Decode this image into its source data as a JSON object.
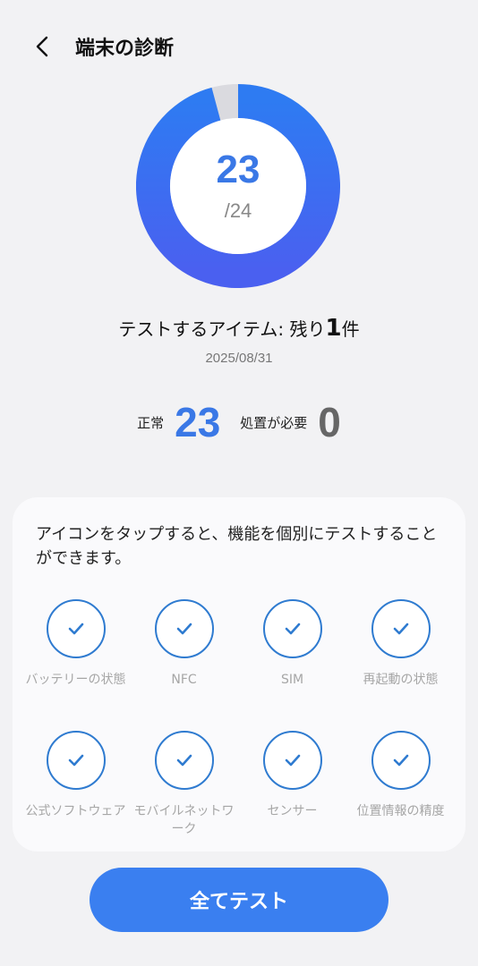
{
  "header": {
    "title": "端末の診断"
  },
  "ring": {
    "passed": 23,
    "count_text": "23",
    "total_text": "/24",
    "colors": {
      "arc_start": "#2e7bf2",
      "arc_end": "#4a60f0",
      "pending": "#d8d8dc"
    }
  },
  "remaining": {
    "prefix": "テストするアイテム: 残り",
    "count": "1",
    "suffix": "件"
  },
  "date": "2025/08/31",
  "stats": {
    "normal_label": "正常",
    "normal_value": "23",
    "action_label": "処置が必要",
    "action_value": "0"
  },
  "card": {
    "description": "アイコンをタップすると、機能を個別にテストすることができます。",
    "items": [
      {
        "label": "バッテリーの状態",
        "icon": "check-icon"
      },
      {
        "label": "NFC",
        "icon": "check-icon"
      },
      {
        "label": "SIM",
        "icon": "check-icon"
      },
      {
        "label": "再起動の状態",
        "icon": "check-icon"
      },
      {
        "label": "公式ソフトウェア",
        "icon": "check-icon"
      },
      {
        "label": "モバイルネットワーク",
        "icon": "check-icon"
      },
      {
        "label": "センサー",
        "icon": "check-icon"
      },
      {
        "label": "位置情報の精度",
        "icon": "check-icon"
      }
    ]
  },
  "test_all_button": "全てテスト"
}
